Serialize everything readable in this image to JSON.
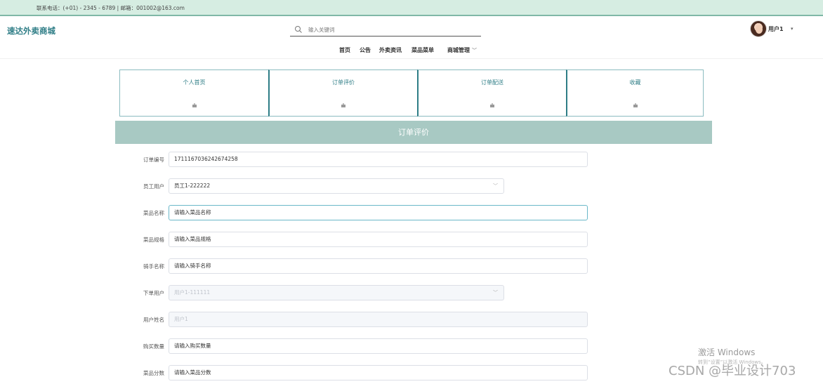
{
  "topbar": {
    "contact": "联系电话：(+01) - 2345 - 6789 | 邮箱：001002@163.com"
  },
  "header": {
    "brand": "速达外卖商城",
    "search_placeholder": "输入关键词",
    "username": "用户1",
    "nav": [
      "首页",
      "公告",
      "外卖资讯",
      "菜品菜单",
      "商城管理"
    ]
  },
  "tabs": [
    "个人首页",
    "订单评价",
    "订单配送",
    "收藏"
  ],
  "section_title": "订单评价",
  "form": [
    {
      "label": "订单编号",
      "value": "1711167036242674258",
      "state": "normal"
    },
    {
      "label": "员工用户",
      "value": "员工1-222222",
      "state": "select"
    },
    {
      "label": "菜品名称",
      "value": "请输入菜品名称",
      "state": "focus"
    },
    {
      "label": "菜品规格",
      "value": "请输入菜品规格",
      "state": "normal"
    },
    {
      "label": "骑手名称",
      "value": "请输入骑手名称",
      "state": "normal"
    },
    {
      "label": "下单用户",
      "value": "用户1-111111",
      "state": "disabled-select"
    },
    {
      "label": "用户姓名",
      "value": "用户1",
      "state": "disabled"
    },
    {
      "label": "购买数量",
      "value": "请输入购买数量",
      "state": "normal"
    },
    {
      "label": "菜品分数",
      "value": "请输入菜品分数",
      "state": "normal"
    }
  ],
  "watermark": {
    "windows_title": "激活 Windows",
    "windows_sub": "转到“设置”以激活 Windows。",
    "csdn": "CSDN @毕业设计703"
  },
  "colors": {
    "accent": "#2e7d86",
    "topbar": "#d6ede2",
    "section": "#a8c9c3",
    "tab_border": "#8bbcc0"
  }
}
